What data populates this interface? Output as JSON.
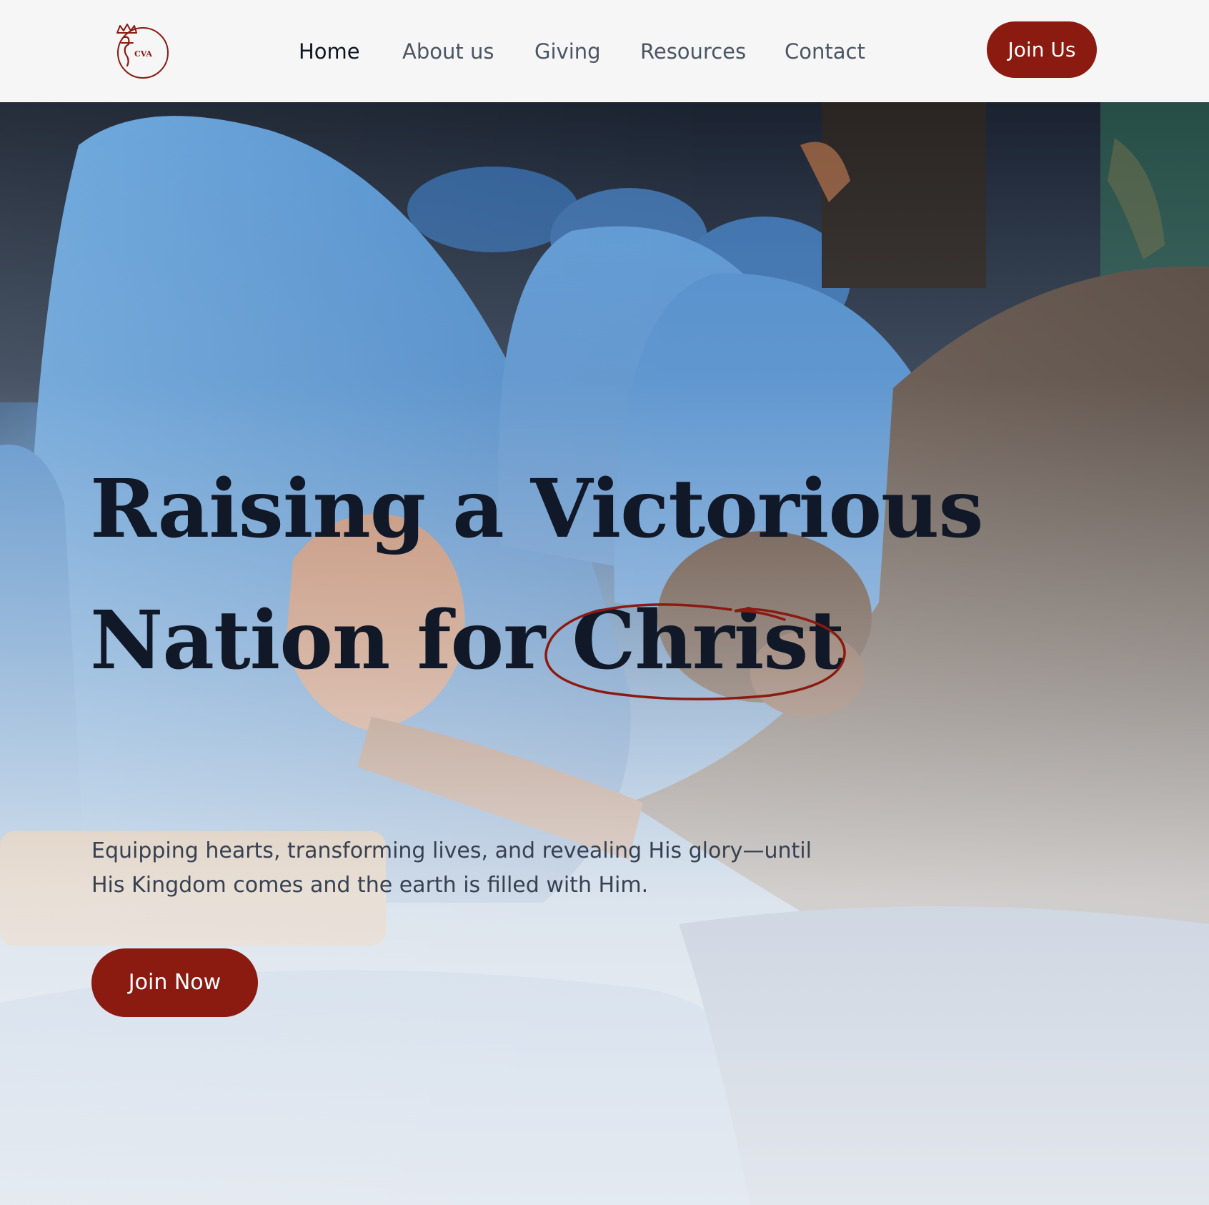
{
  "colors": {
    "accent": "#8b1a11",
    "heading": "#111827",
    "nav_text": "#4b5563",
    "nav_active": "#0f1522",
    "header_bg": "#f6f6f6"
  },
  "header": {
    "logo_text": "CVA",
    "nav": [
      {
        "label": "Home",
        "active": true
      },
      {
        "label": "About us",
        "active": false
      },
      {
        "label": "Giving",
        "active": false
      },
      {
        "label": "Resources",
        "active": false
      },
      {
        "label": "Contact",
        "active": false
      }
    ],
    "cta_label": "Join Us"
  },
  "hero": {
    "title_line1": "Raising a Victorious",
    "title_line2_prefix": "Nation for ",
    "title_highlight": "Christ",
    "subtitle": "Equipping hearts, transforming lives, and revealing His glory—until His Kingdom comes and the earth is filled with Him.",
    "cta_label": "Join Now"
  }
}
